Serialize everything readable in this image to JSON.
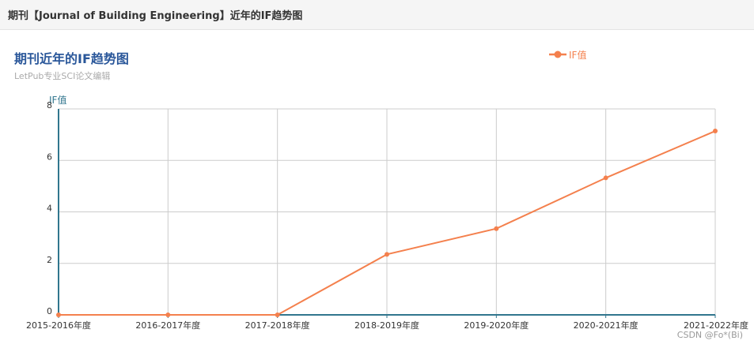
{
  "header": {
    "title": "期刊【Journal of Building Engineering】近年的IF趋势图"
  },
  "colors": {
    "title": "#2a579a",
    "series": "#f4804d",
    "axis": "#31768e",
    "grid": "#cccccc"
  },
  "watermark": "CSDN @Fo*(Bi)",
  "chart_data": {
    "type": "line",
    "title": "期刊近年的IF趋势图",
    "subtitle": "LetPub专业SCI论文编辑",
    "ylabel": "IF值",
    "xlabel": "",
    "categories": [
      "2015-2016年度",
      "2016-2017年度",
      "2017-2018年度",
      "2018-2019年度",
      "2019-2020年度",
      "2020-2021年度",
      "2021-2022年度"
    ],
    "series": [
      {
        "name": "IF值",
        "values": [
          0,
          0,
          0,
          2.35,
          3.35,
          5.32,
          7.14
        ]
      }
    ],
    "yticks": [
      0,
      2,
      4,
      6,
      8
    ],
    "ylim": [
      0,
      8
    ],
    "grid": true,
    "legend_position": "top-right"
  }
}
